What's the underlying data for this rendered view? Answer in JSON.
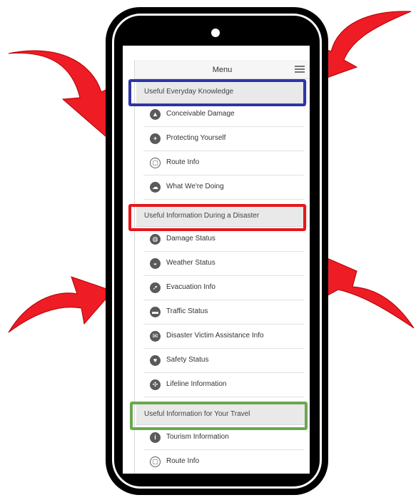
{
  "header": {
    "title": "Menu"
  },
  "sections": [
    {
      "label": "Useful Everyday Knowledge",
      "highlight_color": "#2e35a6",
      "items": [
        {
          "label": "Conceivable Damage",
          "icon": "warning-icon"
        },
        {
          "label": "Protecting Yourself",
          "icon": "first-aid-icon"
        },
        {
          "label": "Route Info",
          "icon": "train-icon"
        },
        {
          "label": "What We're Doing",
          "icon": "cloud-icon"
        }
      ]
    },
    {
      "label": "Useful Information During a Disaster",
      "highlight_color": "#e8151b",
      "items": [
        {
          "label": "Damage Status",
          "icon": "globe-icon"
        },
        {
          "label": "Weather Status",
          "icon": "weather-icon"
        },
        {
          "label": "Evacuation Info",
          "icon": "evacuation-icon"
        },
        {
          "label": "Traffic Status",
          "icon": "car-icon"
        },
        {
          "label": "Disaster Victim Assistance Info",
          "icon": "assistance-icon"
        },
        {
          "label": "Safety Status",
          "icon": "heart-icon"
        },
        {
          "label": "Lifeline Information",
          "icon": "lifeline-icon"
        }
      ]
    },
    {
      "label": "Useful Information for Your Travel",
      "highlight_color": "#6aa84f",
      "items": [
        {
          "label": "Tourism Information",
          "icon": "info-icon"
        },
        {
          "label": "Route Info",
          "icon": "train-icon"
        }
      ]
    }
  ],
  "arrow_color": "#ee1c25"
}
